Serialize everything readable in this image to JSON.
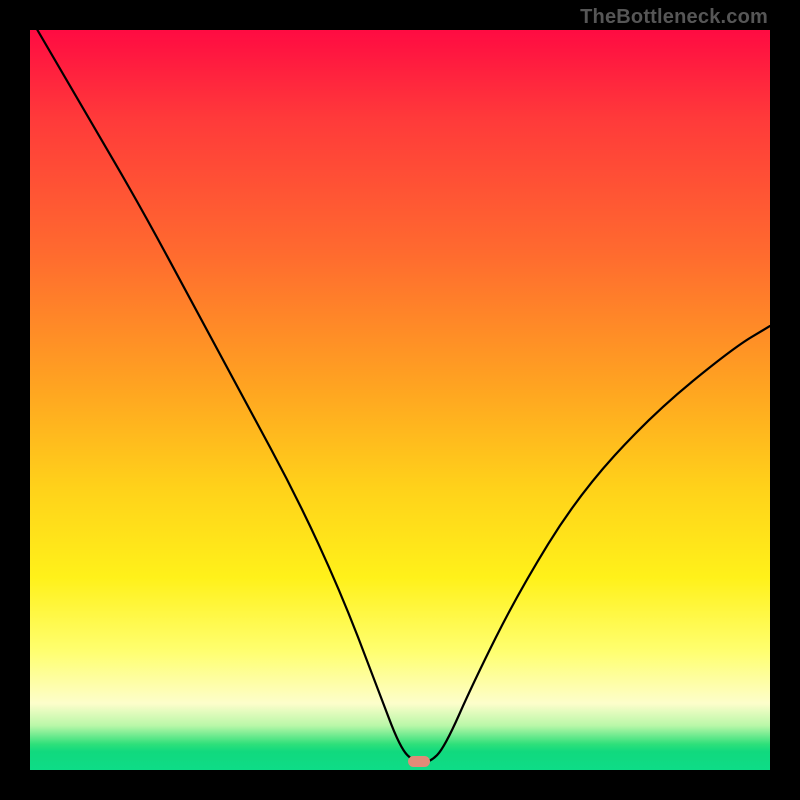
{
  "watermark": "TheBottleneck.com",
  "chart_data": {
    "type": "line",
    "title": "",
    "xlabel": "",
    "ylabel": "",
    "xlim": [
      0,
      100
    ],
    "ylim": [
      0,
      100
    ],
    "grid": false,
    "legend": false,
    "series": [
      {
        "name": "bottleneck-curve",
        "x": [
          1,
          8,
          15,
          22,
          29,
          36,
          42,
          47,
          50,
          52,
          54,
          56,
          60,
          66,
          74,
          84,
          95,
          100
        ],
        "values": [
          100,
          88,
          76,
          63,
          50,
          37,
          24,
          11,
          3,
          1,
          1,
          3,
          12,
          24,
          37,
          48,
          57,
          60
        ]
      }
    ],
    "annotations": [
      {
        "name": "optimal-marker",
        "x": 52.5,
        "y": 1.2,
        "color": "#e08b78"
      }
    ],
    "background": {
      "type": "vertical-gradient",
      "stops": [
        {
          "pos": 0,
          "color": "#ff0b42"
        },
        {
          "pos": 0.48,
          "color": "#ffa321"
        },
        {
          "pos": 0.74,
          "color": "#fff11a"
        },
        {
          "pos": 0.94,
          "color": "#b9f7a8"
        },
        {
          "pos": 1.0,
          "color": "#0edc87"
        }
      ]
    }
  }
}
